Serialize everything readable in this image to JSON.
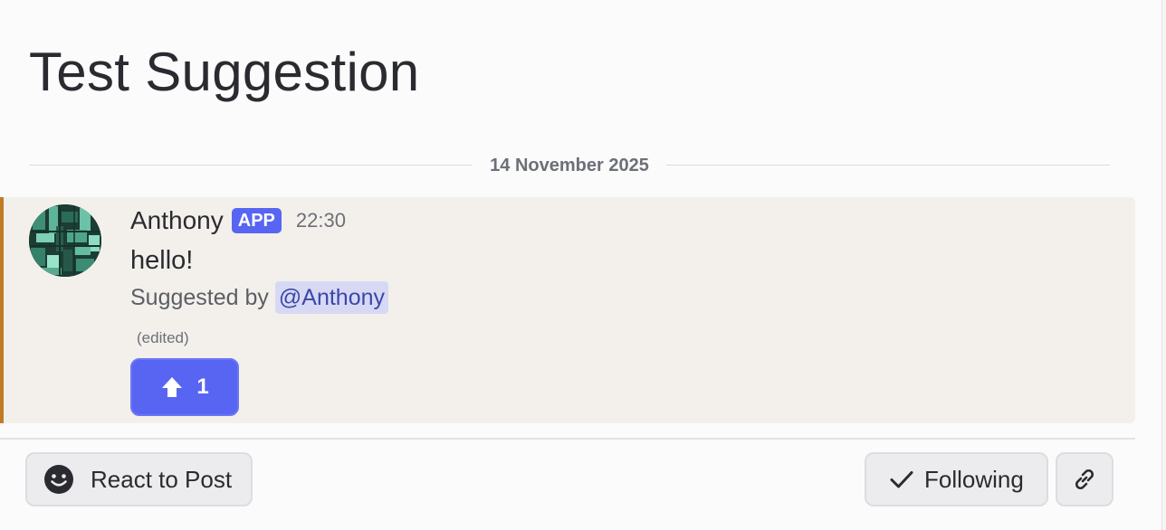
{
  "post": {
    "title": "Test Suggestion",
    "date_divider": "14 November 2025"
  },
  "message": {
    "author": "Anthony",
    "badge": "APP",
    "timestamp": "22:30",
    "text": "hello!",
    "suggested_label": "Suggested by",
    "mention": "@Anthony",
    "edited_label": "(edited)",
    "reaction": {
      "icon": "upvote-arrow-icon",
      "count": "1"
    }
  },
  "actions": {
    "react_label": "React to Post",
    "react_icon": "smiley-face-icon",
    "follow_label": "Following",
    "follow_icon": "checkmark-icon",
    "link_icon": "link-icon"
  },
  "colors": {
    "accent_bar": "#c17b24",
    "blurple": "#5865f2",
    "message_highlight": "#f3f0eb",
    "mention_bg": "#d7d9f4"
  }
}
